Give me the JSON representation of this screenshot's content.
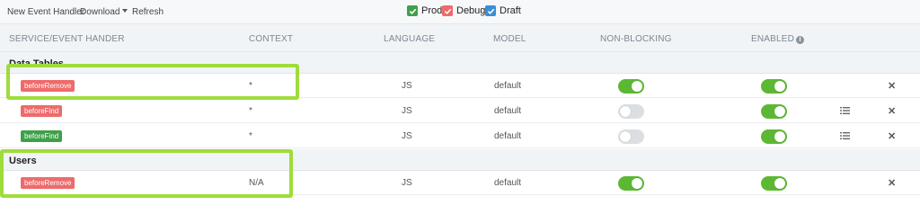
{
  "toolbar": {
    "new_event_handler": "New Event Handler",
    "download": "Download",
    "refresh": "Refresh",
    "filters": [
      {
        "label": "Prod",
        "color": "#3fa04a"
      },
      {
        "label": "Debug",
        "color": "#ee6b6b"
      },
      {
        "label": "Draft",
        "color": "#3a8fd6"
      }
    ]
  },
  "columns": {
    "service": "SERVICE/EVENT HANDER",
    "context": "CONTEXT",
    "language": "LANGUAGE",
    "model": "MODEL",
    "non_blocking": "NON-BLOCKING",
    "enabled": "ENABLED"
  },
  "groups": [
    {
      "label": "Data Tables",
      "rows": [
        {
          "handler": "beforeRemove",
          "badge_color": "red",
          "context": "*",
          "language": "JS",
          "model": "default",
          "non_blocking": true,
          "enabled": true,
          "has_list_icon": false
        },
        {
          "handler": "beforeFind",
          "badge_color": "red",
          "context": "*",
          "language": "JS",
          "model": "default",
          "non_blocking": false,
          "enabled": true,
          "has_list_icon": true
        },
        {
          "handler": "beforeFind",
          "badge_color": "green",
          "context": "*",
          "language": "JS",
          "model": "default",
          "non_blocking": false,
          "enabled": true,
          "has_list_icon": true
        }
      ]
    },
    {
      "label": "Users",
      "rows": [
        {
          "handler": "beforeRemove",
          "badge_color": "red",
          "context": "N/A",
          "language": "JS",
          "model": "default",
          "non_blocking": true,
          "enabled": true,
          "has_list_icon": false
        }
      ]
    }
  ],
  "colors": {
    "highlight": "#9fdc3b",
    "toggle_on": "#5cb832",
    "toggle_off": "#dcdfe2"
  }
}
